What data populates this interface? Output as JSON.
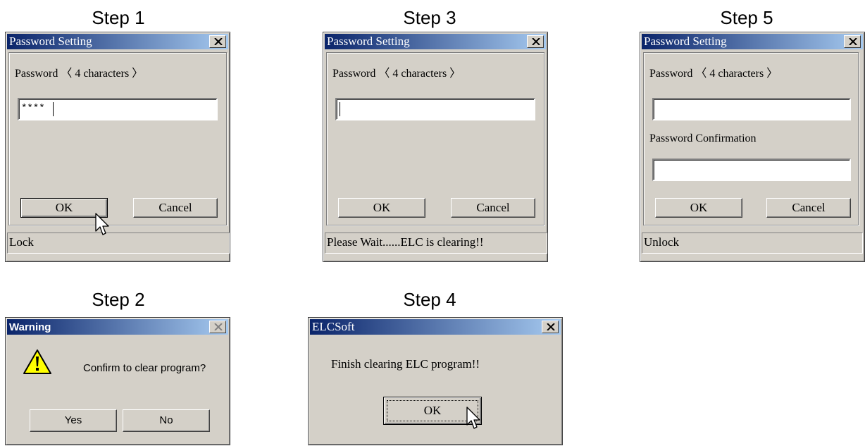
{
  "steps": {
    "step1": "Step 1",
    "step2": "Step 2",
    "step3": "Step 3",
    "step4": "Step 4",
    "step5": "Step 5"
  },
  "step1_dialog": {
    "title": "Password Setting",
    "password_label": "Password 〈 4 characters 〉",
    "password_value": "****",
    "ok_label": "OK",
    "cancel_label": "Cancel",
    "status": "Lock"
  },
  "step3_dialog": {
    "title": "Password Setting",
    "password_label": "Password 〈 4 characters 〉",
    "password_value": "",
    "ok_label": "OK",
    "cancel_label": "Cancel",
    "status": "Please Wait......ELC is clearing!!"
  },
  "step5_dialog": {
    "title": "Password Setting",
    "password_label": "Password 〈 4 characters 〉",
    "password_value": "",
    "confirm_label": "Password Confirmation",
    "confirm_value": "",
    "ok_label": "OK",
    "cancel_label": "Cancel",
    "status": "Unlock"
  },
  "step2_dialog": {
    "title": "Warning",
    "message": "Confirm to clear program?",
    "icon": "warning-icon",
    "yes_label": "Yes",
    "no_label": "No"
  },
  "step4_dialog": {
    "title": "ELCSoft",
    "message": "Finish clearing ELC program!!",
    "ok_label": "OK"
  },
  "colors": {
    "dialog_face": "#d4d0c8",
    "title_start": "#0a246a",
    "title_end": "#a6caf0"
  }
}
